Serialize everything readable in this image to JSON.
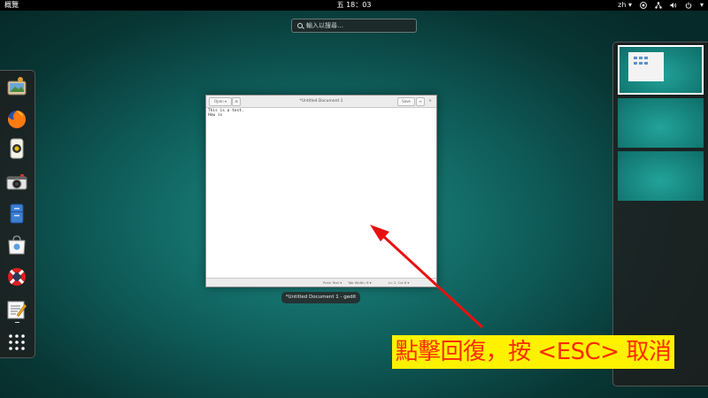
{
  "topbar": {
    "activities": "概覽",
    "clock": "五 18：03",
    "lang": "zh ▾",
    "icons": [
      "accessibility-icon",
      "network-icon",
      "volume-icon",
      "power-icon"
    ]
  },
  "search": {
    "placeholder": "輸入以搜尋…"
  },
  "dash": {
    "apps": [
      {
        "name": "shotwell-app-icon",
        "running": false
      },
      {
        "name": "firefox-app-icon",
        "running": false
      },
      {
        "name": "rhythmbox-app-icon",
        "running": false
      },
      {
        "name": "cheese-app-icon",
        "running": false
      },
      {
        "name": "files-app-icon",
        "running": false
      },
      {
        "name": "software-app-icon",
        "running": false
      },
      {
        "name": "help-app-icon",
        "running": false
      },
      {
        "name": "gedit-app-icon",
        "running": true
      }
    ],
    "show_apps_icon": "grid-icon"
  },
  "window": {
    "open_label": "Open ▾",
    "title": "*Untitled Document 1",
    "save_label": "Save",
    "menu_icon": "hamburger-icon",
    "close_icon": "close-icon",
    "text_lines": [
      "This is a test.",
      "How is"
    ],
    "status": {
      "syntax": "Plain Text ▾",
      "tabwidth": "Tab Width: 8 ▾",
      "position": "Ln 2, Col 6 ▾"
    },
    "caption": "*Untitled Document 1 - gedit"
  },
  "workspaces": {
    "count": 3,
    "active": 0
  },
  "overlay": {
    "banner_text": "點擊回復，按 <ESC> 取消",
    "banner_bg": "#fff200",
    "banner_fg": "#ff2a00",
    "arrow_color": "#e81010"
  }
}
